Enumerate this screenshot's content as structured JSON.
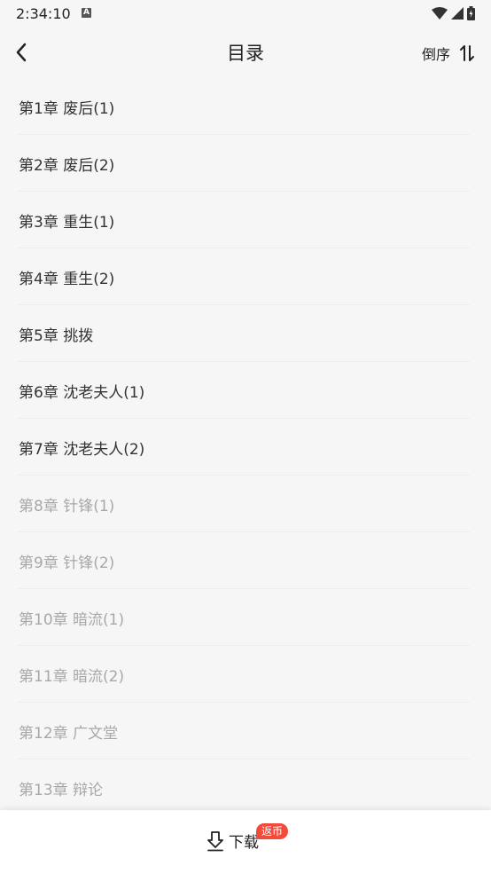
{
  "status_bar": {
    "time": "2:34:10",
    "notification_icon": "a-icon"
  },
  "header": {
    "title": "目录",
    "sort_label": "倒序"
  },
  "chapters": [
    {
      "label": "第1章 废后(1)",
      "unlocked": true
    },
    {
      "label": "第2章 废后(2)",
      "unlocked": true
    },
    {
      "label": "第3章 重生(1)",
      "unlocked": true
    },
    {
      "label": "第4章 重生(2)",
      "unlocked": true
    },
    {
      "label": "第5章 挑拨",
      "unlocked": true
    },
    {
      "label": "第6章 沈老夫人(1)",
      "unlocked": true
    },
    {
      "label": "第7章 沈老夫人(2)",
      "unlocked": true
    },
    {
      "label": "第8章 针锋(1)",
      "unlocked": false
    },
    {
      "label": "第9章 针锋(2)",
      "unlocked": false
    },
    {
      "label": "第10章 暗流(1)",
      "unlocked": false
    },
    {
      "label": "第11章 暗流(2)",
      "unlocked": false
    },
    {
      "label": "第12章 广文堂",
      "unlocked": false
    },
    {
      "label": "第13章 辩论",
      "unlocked": false
    }
  ],
  "bottom_bar": {
    "download_label": "下载",
    "badge": "返币"
  },
  "colors": {
    "badge_bg": "#f24b3c",
    "read_text": "#333333",
    "unread_text": "#a8a8a8"
  }
}
